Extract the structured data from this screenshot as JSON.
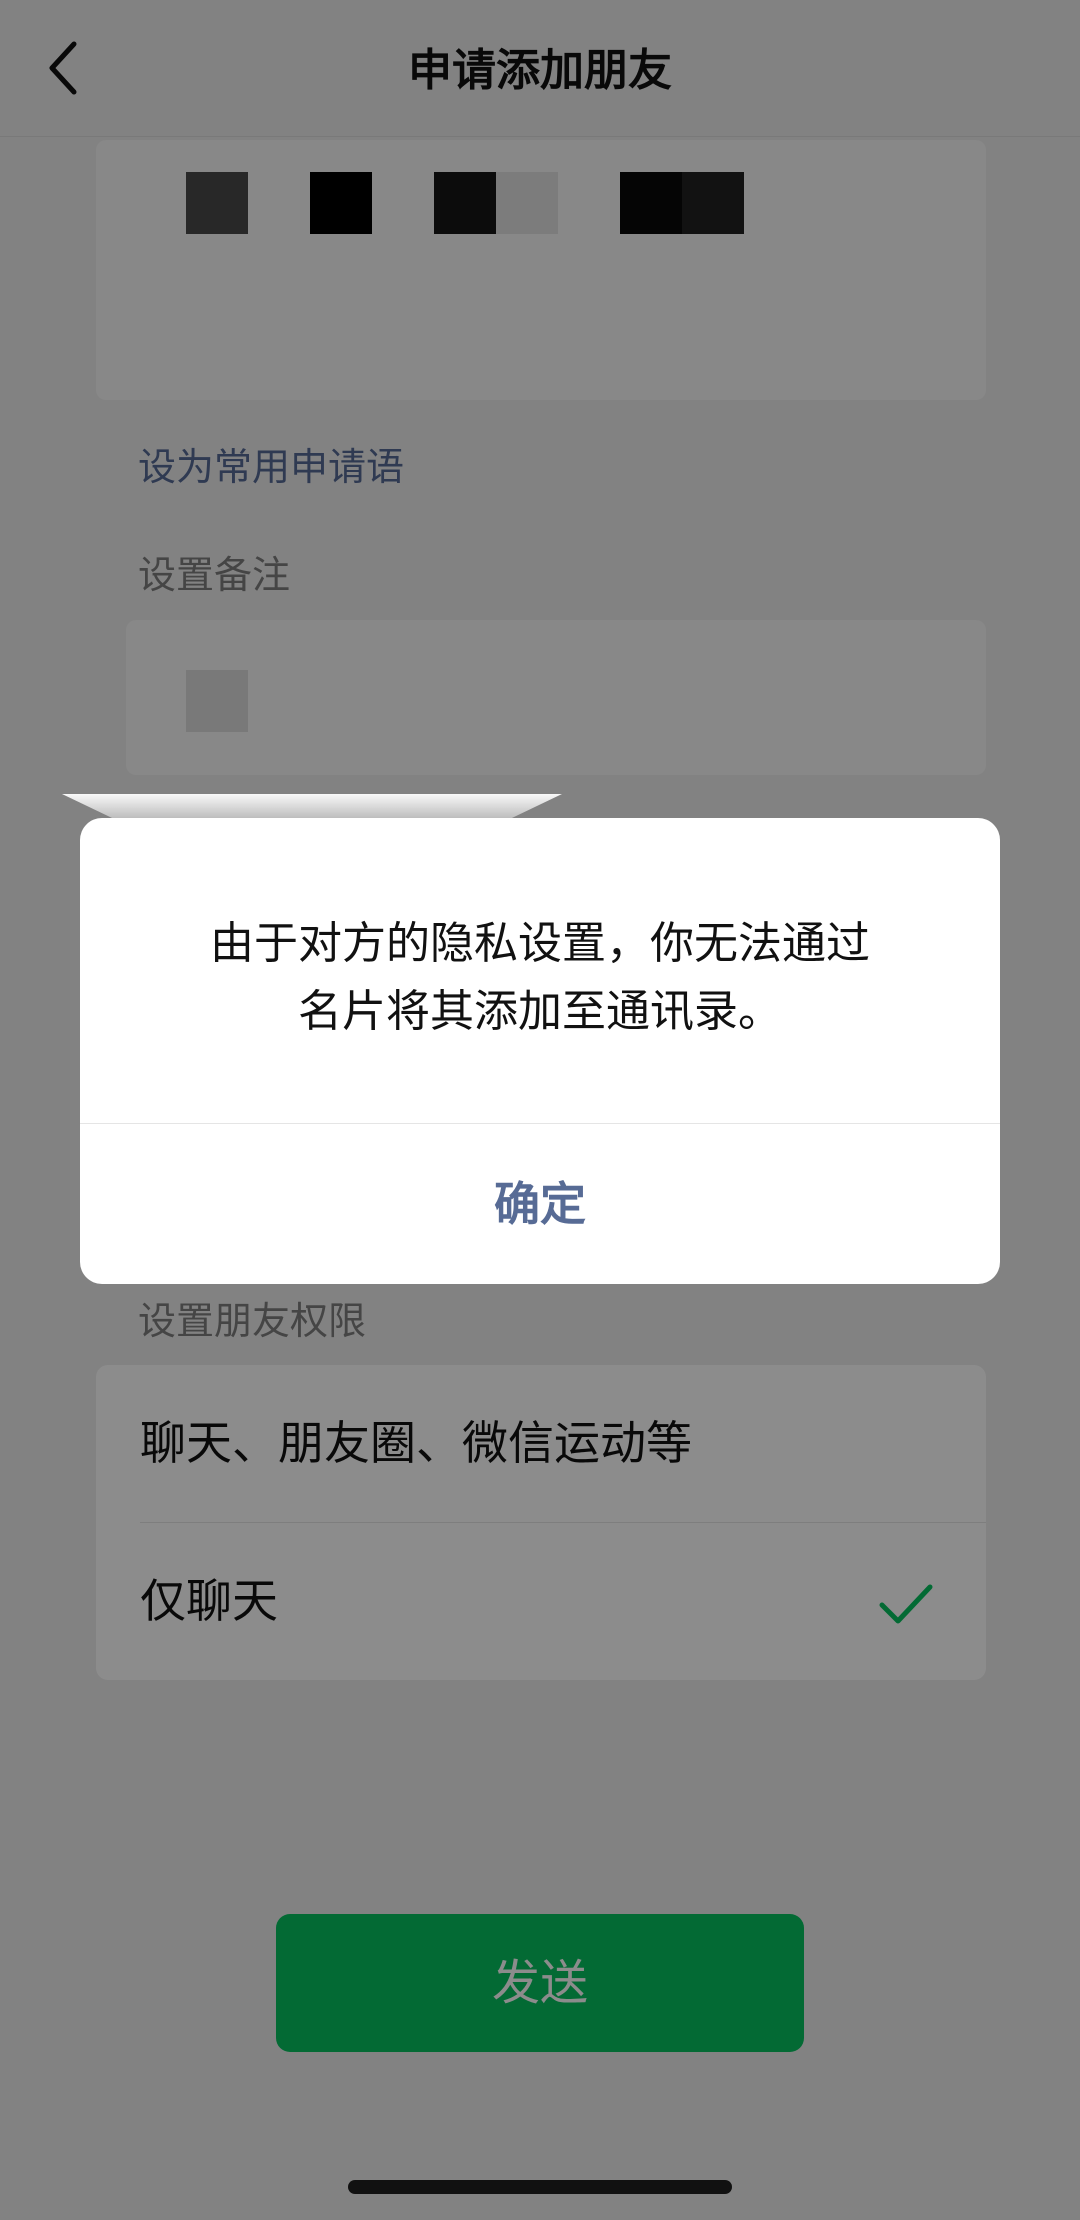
{
  "header": {
    "title": "申请添加朋友",
    "back_icon": "chevron-left-icon"
  },
  "form": {
    "set_common_phrase": "设为常用申请语",
    "remark_label": "设置备注",
    "permission_label": "设置朋友权限",
    "permissions": [
      {
        "label": "聊天、朋友圈、微信运动等",
        "selected": false
      },
      {
        "label": "仅聊天",
        "selected": true
      }
    ],
    "check_icon": "check-icon"
  },
  "send_button": {
    "label": "发送"
  },
  "dialog": {
    "message_line1": "由于对方的隐私设置，你无法通过",
    "message_line2": "名片将其添加至通讯录。",
    "confirm": "确定"
  },
  "colors": {
    "accent_green": "#07c160",
    "link_blue": "#576b95"
  }
}
